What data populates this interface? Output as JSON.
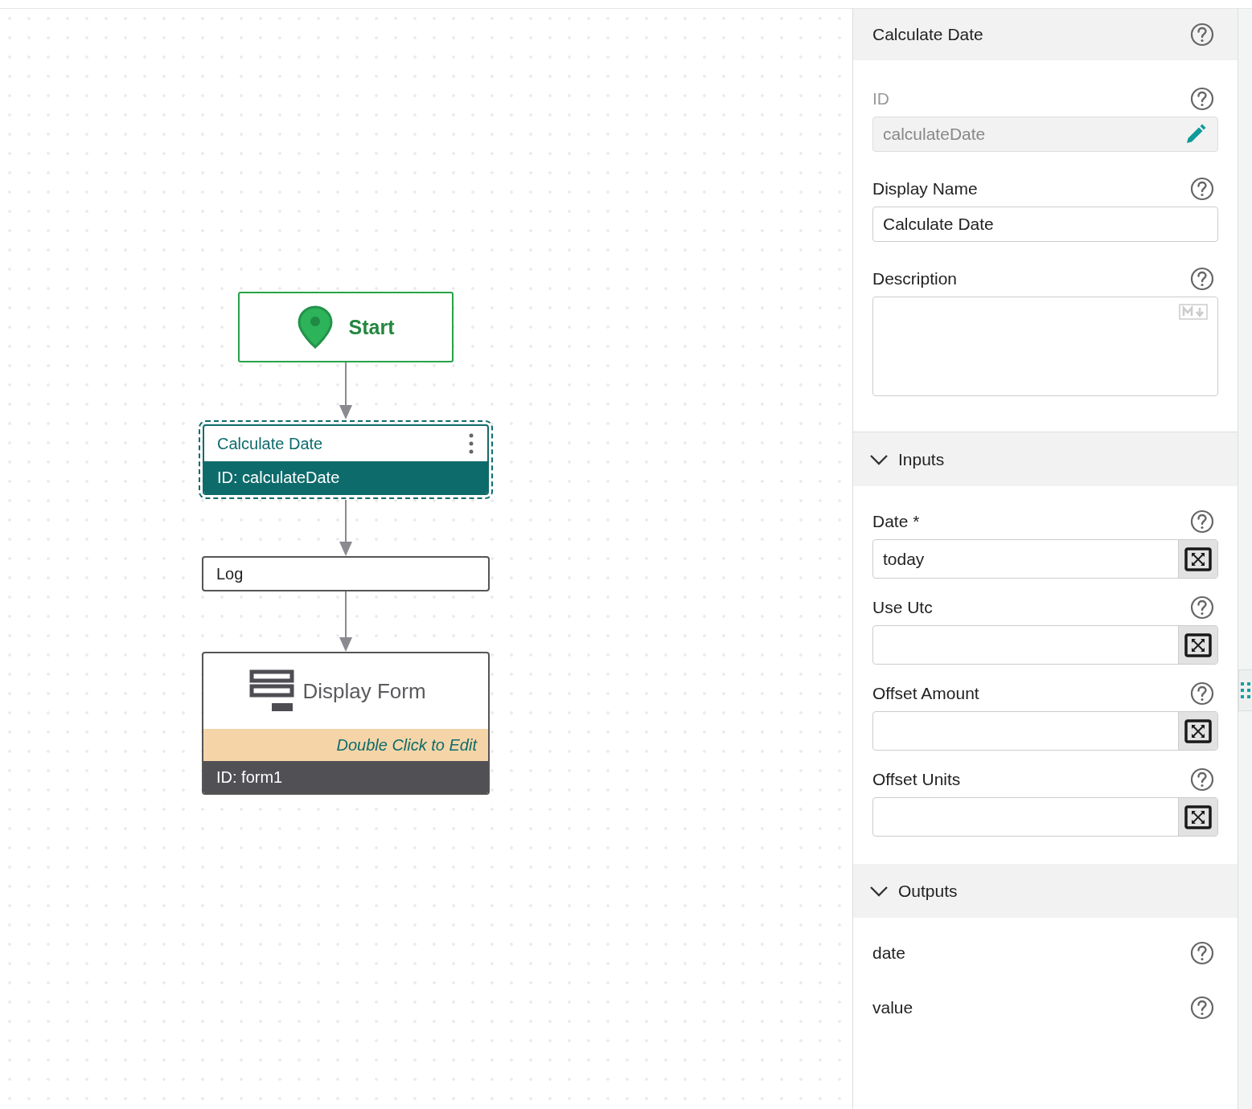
{
  "canvas": {
    "nodes": [
      {
        "kind": "start",
        "label": "Start",
        "selected": false
      },
      {
        "kind": "activity",
        "title": "Calculate Date",
        "id_text": "ID: calculateDate",
        "selected": true
      },
      {
        "kind": "simple",
        "title": "Log",
        "selected": false
      },
      {
        "kind": "form",
        "title": "Display Form",
        "hint": "Double Click to Edit",
        "id_text": "ID: form1",
        "selected": false
      }
    ]
  },
  "panel": {
    "title": "Calculate Date",
    "fields": [
      {
        "kind": "readonly",
        "label": "ID",
        "value": "calculateDate"
      },
      {
        "kind": "text",
        "label": "Display Name",
        "value": "Calculate Date"
      },
      {
        "kind": "markdown",
        "label": "Description"
      }
    ],
    "sections": [
      {
        "title": "Inputs",
        "expanded": true,
        "items": [
          {
            "kind": "expression",
            "label": "Date *",
            "value": "today"
          },
          {
            "kind": "expression",
            "label": "Use Utc"
          },
          {
            "kind": "expression",
            "label": "Offset Amount"
          },
          {
            "kind": "expression",
            "label": "Offset Units"
          }
        ]
      },
      {
        "title": "Outputs",
        "expanded": true,
        "items": [
          {
            "kind": "output",
            "label": "date"
          },
          {
            "kind": "output",
            "label": "value"
          }
        ]
      }
    ]
  }
}
